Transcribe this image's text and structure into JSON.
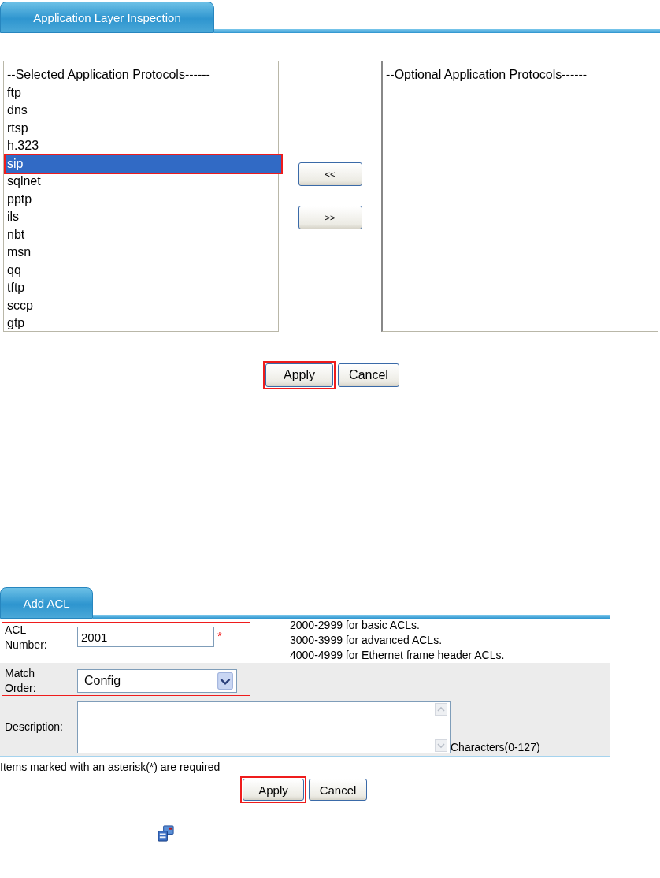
{
  "inspection_tab": {
    "label": "Application Layer Inspection",
    "selected": true
  },
  "selected_list": {
    "heading": "--Selected Application Protocols------",
    "items": [
      {
        "label": "ftp",
        "selected": false,
        "highlighted": false
      },
      {
        "label": "dns",
        "selected": false,
        "highlighted": false
      },
      {
        "label": "rtsp",
        "selected": false,
        "highlighted": false
      },
      {
        "label": "h.323",
        "selected": false,
        "highlighted": false
      },
      {
        "label": "sip",
        "selected": true,
        "highlighted": true
      },
      {
        "label": "sqlnet",
        "selected": false,
        "highlighted": false
      },
      {
        "label": "pptp",
        "selected": false,
        "highlighted": false
      },
      {
        "label": "ils",
        "selected": false,
        "highlighted": false
      },
      {
        "label": "nbt",
        "selected": false,
        "highlighted": false
      },
      {
        "label": "msn",
        "selected": false,
        "highlighted": false
      },
      {
        "label": "qq",
        "selected": false,
        "highlighted": false
      },
      {
        "label": "tftp",
        "selected": false,
        "highlighted": false
      },
      {
        "label": "sccp",
        "selected": false,
        "highlighted": false
      },
      {
        "label": "gtp",
        "selected": false,
        "highlighted": false
      }
    ]
  },
  "move_buttons": [
    "<<",
    ">>"
  ],
  "optional_list": {
    "heading": "--Optional Application Protocols------"
  },
  "inspection_actions": [
    {
      "label": "Apply",
      "highlighted": true
    },
    {
      "label": "Cancel",
      "highlighted": false
    }
  ],
  "acl_tab": {
    "label": "Add ACL",
    "selected": true
  },
  "acl_form": {
    "highlighted": true,
    "acl_number": {
      "label": "ACL Number:",
      "value": "2001",
      "required_mark": "*"
    },
    "ranges": [
      "2000-2999 for basic ACLs.",
      "3000-3999 for advanced ACLs.",
      "4000-4999 for Ethernet frame header ACLs."
    ],
    "match_order": {
      "label": "Match Order:",
      "value": "Config"
    },
    "description": {
      "label": "Description:",
      "hint": "Characters(0-127)"
    }
  },
  "required_note": "Items marked with an asterisk(*) are required",
  "acl_actions": [
    {
      "label": "Apply",
      "highlighted": true
    },
    {
      "label": "Cancel",
      "highlighted": false
    }
  ]
}
